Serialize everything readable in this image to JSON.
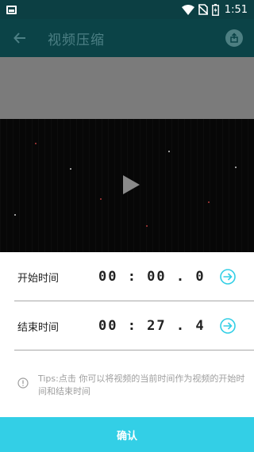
{
  "status_bar": {
    "time": "1:51",
    "icons": [
      "notification-icon",
      "wifi-icon",
      "no-sim-icon",
      "battery-charging-icon"
    ]
  },
  "app_bar": {
    "title": "视频压缩",
    "back_icon": "arrow-back-icon",
    "action_icon": "share-icon"
  },
  "video": {
    "play_icon": "play-icon"
  },
  "time_panel": {
    "start": {
      "label": "开始时间",
      "value": "00 : 00 . 0",
      "action_icon": "arrow-circle-right-icon"
    },
    "end": {
      "label": "结束时间",
      "value": "00 : 27 . 4",
      "action_icon": "arrow-circle-right-icon"
    },
    "tips": "Tips:点击    你可以将视频的当前时间作为视频的开始时间和结束时间",
    "tips_icon": "info-icon"
  },
  "confirm_button": {
    "label": "确认"
  },
  "colors": {
    "accent": "#33cfe6",
    "appbar_dimmed": "#0b4347",
    "statusbar_dimmed": "#0c3f43"
  }
}
